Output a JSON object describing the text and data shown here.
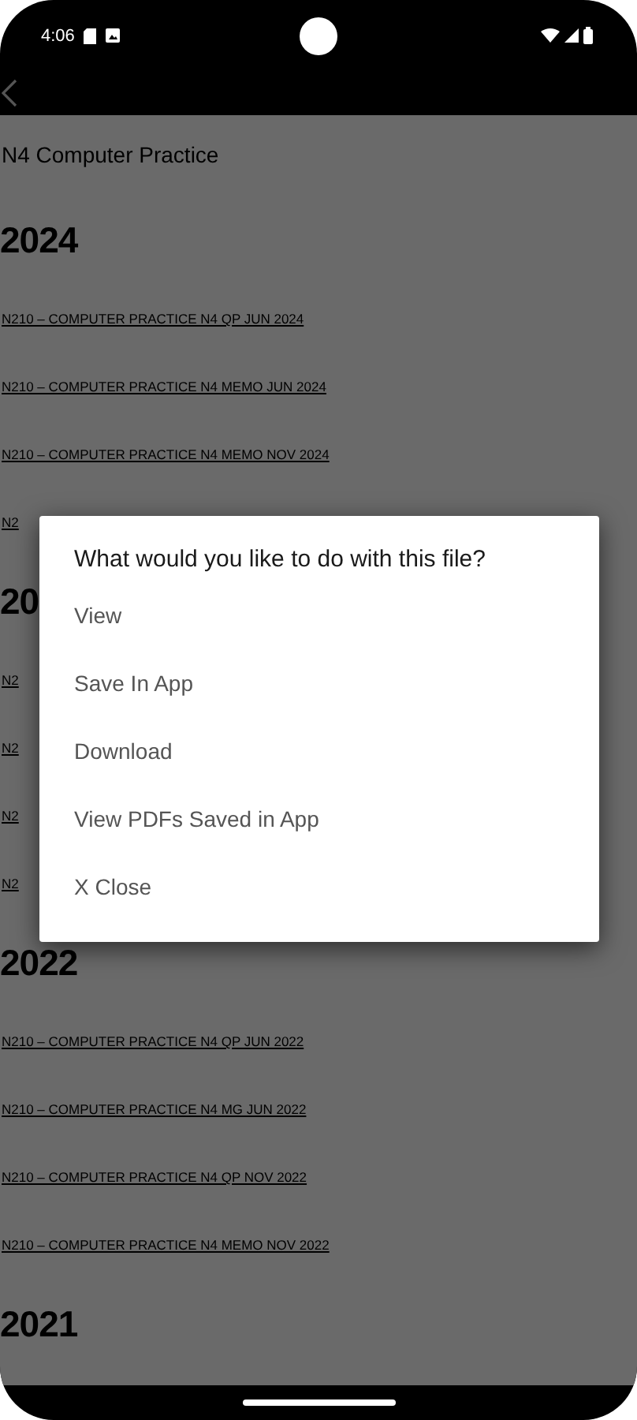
{
  "status_bar": {
    "time": "4:06"
  },
  "page_title": "N4 Computer Practice",
  "sections": [
    {
      "year": "2024",
      "links": [
        "N210 – COMPUTER PRACTICE N4 QP JUN 2024",
        "N210 – COMPUTER PRACTICE N4 MEMO JUN 2024",
        "N210 – COMPUTER PRACTICE N4 MEMO NOV 2024",
        "N2"
      ]
    },
    {
      "year": "20",
      "links": [
        "N2",
        "N2",
        "N2",
        "N2"
      ]
    },
    {
      "year": "2022",
      "links": [
        "N210 – COMPUTER PRACTICE N4 QP JUN 2022",
        "N210 – COMPUTER PRACTICE N4 MG JUN 2022",
        "N210 – COMPUTER PRACTICE N4 QP NOV 2022",
        "N210 – COMPUTER PRACTICE N4 MEMO NOV 2022"
      ]
    },
    {
      "year": "2021"
    }
  ],
  "dialog": {
    "title": "What would you like to do with this file?",
    "options": [
      "View",
      "Save In App",
      "Download",
      "View PDFs Saved in App",
      "X Close"
    ]
  }
}
